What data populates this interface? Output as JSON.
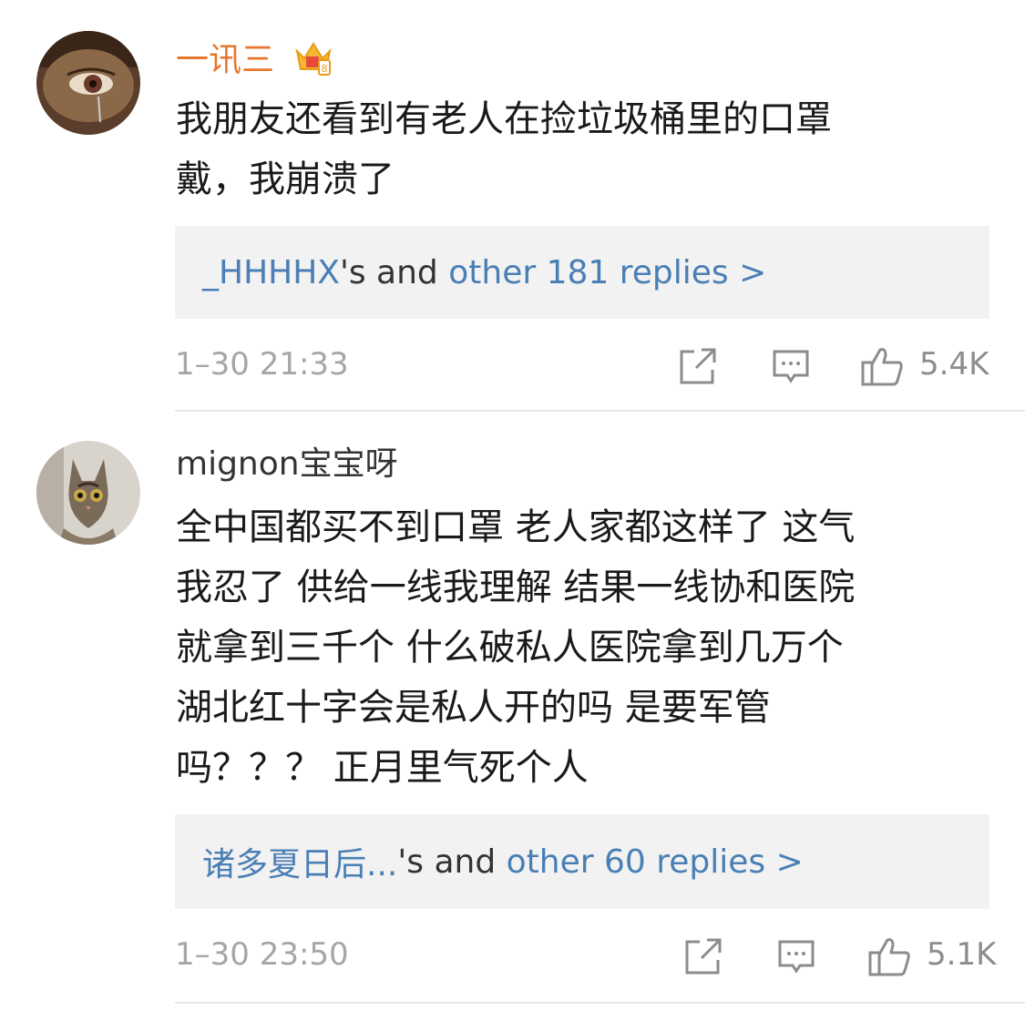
{
  "comments": [
    {
      "username": "一讯三",
      "username_color": "#e8772e",
      "badge_icon": "crown-member-icon",
      "text_lines": [
        "我朋友还看到有老人在捡垃圾桶里的口罩",
        "戴，我崩溃了"
      ],
      "replies": {
        "first_replier": "_HHHHX",
        "connector": "'s and ",
        "other_text": "other 181 replies >"
      },
      "timestamp": "1–30 21:33",
      "likes": "5.4K"
    },
    {
      "username": "mignon宝宝呀",
      "username_color": "#333333",
      "text_lines": [
        "全中国都买不到口罩 老人家都这样了 这气",
        "我忍了 供给一线我理解 结果一线协和医院",
        "就拿到三千个 什么破私人医院拿到几万个",
        "湖北红十字会是私人开的吗 是要军管",
        "吗？？？ 正月里气死个人"
      ],
      "replies": {
        "first_replier": "诸多夏日后...",
        "connector": "'s and ",
        "other_text": "other 60 replies >"
      },
      "timestamp": "1–30 23:50",
      "likes": "5.1K"
    }
  ],
  "icons": {
    "share": "share-icon",
    "comment": "comment-icon",
    "like": "thumbs-up-icon"
  },
  "colors": {
    "link": "#4a7fb5",
    "meta": "#a6a6a6",
    "reply_bg": "#f2f2f2"
  }
}
